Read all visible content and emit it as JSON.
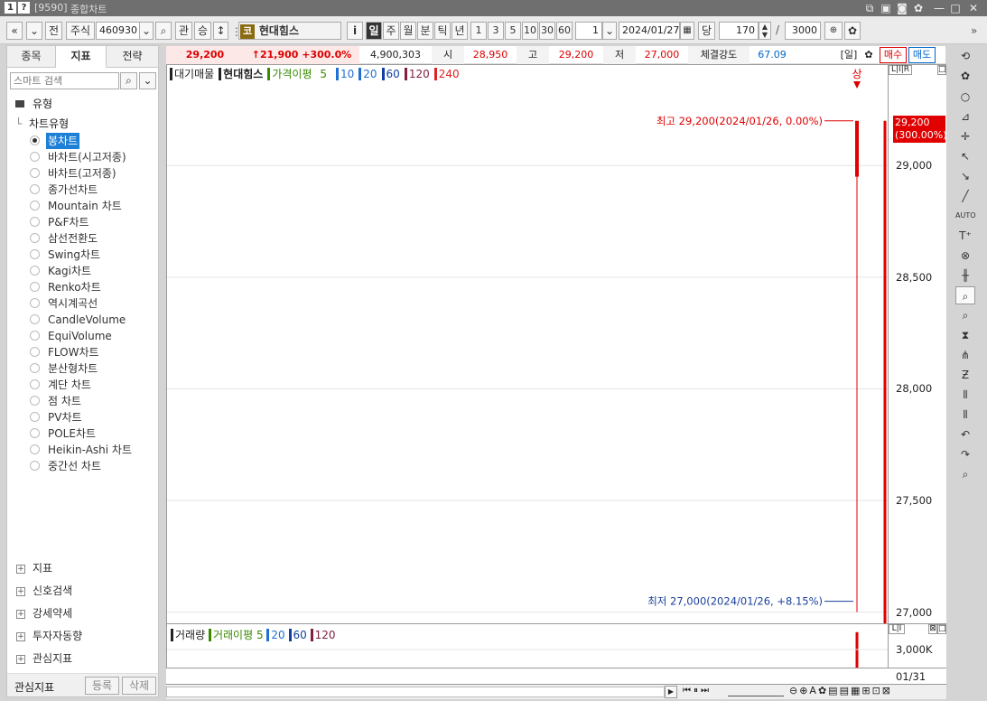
{
  "window": {
    "code": "[9590]",
    "title": "종합차트",
    "badge1": "1",
    "badge2": "?"
  },
  "toolbar": {
    "nav_prev": "«",
    "nav_down": "»",
    "btn_jeon": "전",
    "market": "주식",
    "code": "460930",
    "search": "⌕",
    "btn_gwan": "관",
    "btn_sang": "승",
    "btn_spin": "↕",
    "kospi_badge": "코",
    "stock_name": "현대힘스",
    "info": "i",
    "periods": [
      "일",
      "주",
      "월",
      "분",
      "틱",
      "년"
    ],
    "active_period": "일",
    "intervals": [
      "1",
      "3",
      "5",
      "10",
      "30",
      "60"
    ],
    "interval_value": "1",
    "date": "2024/01/27",
    "btn_dang": "당",
    "count": "170",
    "slash": "/",
    "total": "3000",
    "expand": "»"
  },
  "left": {
    "tabs": [
      "종목",
      "지표",
      "전략"
    ],
    "search_placeholder": "스마트 검색",
    "root": "유형",
    "group": "차트유형",
    "chart_types": [
      "봉차트",
      "바차트(시고저종)",
      "바차트(고저종)",
      "종가선차트",
      "Mountain 차트",
      "P&F차트",
      "삼선전환도",
      "Swing차트",
      "Kagi차트",
      "Renko차트",
      "역시계곡선",
      "CandleVolume",
      "EquiVolume",
      "FLOW차트",
      "분산형차트",
      "계단 차트",
      "점 차트",
      "PV차트",
      "POLE차트",
      "Heikin-Ashi 차트",
      "중간선 차트"
    ],
    "selected": "봉차트",
    "sections": [
      "지표",
      "신호검색",
      "강세약세",
      "투자자동향",
      "관심지표"
    ],
    "footer_label": "관심지표",
    "footer_btn1": "등록",
    "footer_btn2": "삭제"
  },
  "quote": {
    "price": "29,200",
    "change": "↑21,900 +300.0%",
    "volume": "4,900,303",
    "open_label": "시",
    "open": "28,950",
    "high_label": "고",
    "high": "29,200",
    "low_label": "저",
    "low": "27,000",
    "strength_label": "체결강도",
    "strength": "67.09",
    "period_tag": "[일]",
    "buy": "매수",
    "sell": "매도"
  },
  "legend": {
    "series": "대기매물",
    "name": "현대힘스",
    "ma_label": "가격이평",
    "ma": [
      "5",
      "10",
      "20",
      "60",
      "120",
      "240"
    ]
  },
  "chart_data": {
    "type": "candlestick",
    "ylim": [
      26950,
      29450
    ],
    "yticks": [
      "29,000",
      "28,500",
      "28,000",
      "27,500",
      "27,000"
    ],
    "ytick_values": [
      29000,
      28500,
      28000,
      27500,
      27000
    ],
    "candles": [
      {
        "date": "2024/01/26",
        "open": 28950,
        "high": 29200,
        "low": 27000,
        "close": 29200
      }
    ],
    "last_label": "29,200",
    "last_pct": "(300.00%)",
    "high_annotation": "최고 29,200(2024/01/26, 0.00%)",
    "low_annotation": "최저 27,000(2024/01/26, +8.15%)",
    "limit_up": "상",
    "volume": {
      "label": "거래량",
      "ma_label": "거래이평",
      "ma": [
        "5",
        "20",
        "60",
        "120"
      ],
      "tick": "3,000K",
      "value": 4900303
    },
    "x_tick": "01/31",
    "colors": {
      "up": "#e00000",
      "ma5": "#3a8a00",
      "ma10": "#2070d0",
      "ma20": "#2070d0",
      "ma60": "#1040a0",
      "ma120": "#802040",
      "ma240": "#e02020"
    }
  },
  "chart_labels": {
    "lir": "L|I|R",
    "lixr": "L|I"
  }
}
